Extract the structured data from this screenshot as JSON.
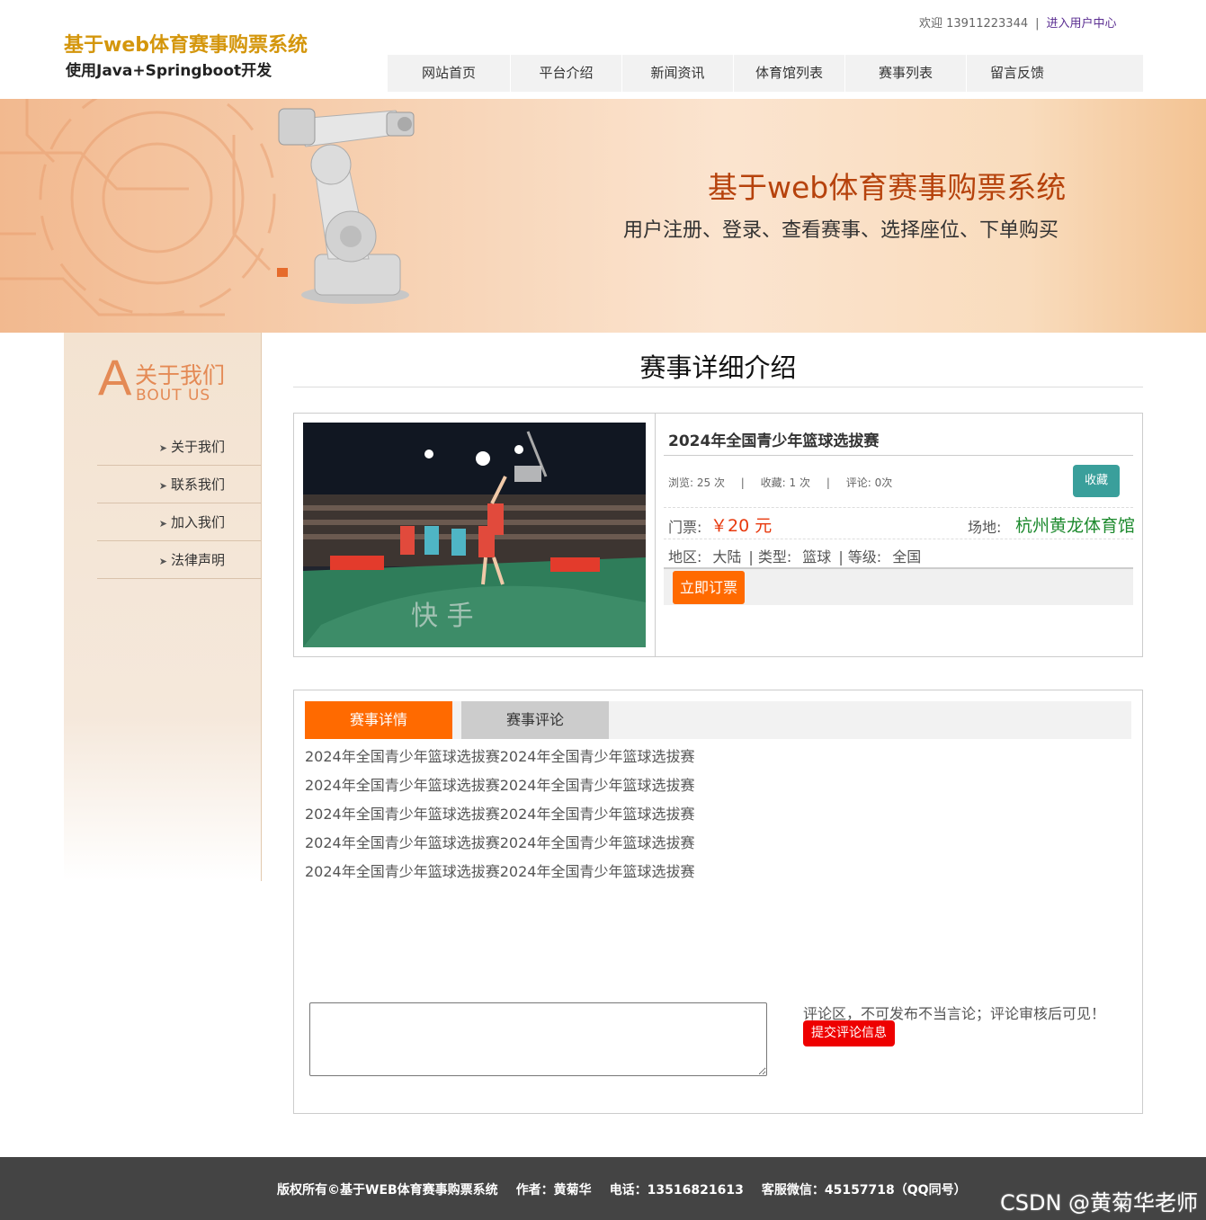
{
  "header": {
    "logo_title": "基于web体育赛事购票系统",
    "logo_subtitle": "使用Java+Springboot开发",
    "welcome": "欢迎 13911223344",
    "separator": "|",
    "user_center_link": "进入用户中心"
  },
  "nav": {
    "items": [
      {
        "label": "网站首页"
      },
      {
        "label": "平台介绍"
      },
      {
        "label": "新闻资讯"
      },
      {
        "label": "体育馆列表"
      },
      {
        "label": "赛事列表"
      },
      {
        "label": "留言反馈"
      }
    ]
  },
  "banner": {
    "title": "基于web体育赛事购票系统",
    "subtitle": "用户注册、登录、查看赛事、选择座位、下单购买"
  },
  "sidebar": {
    "about_letter": "A",
    "about_cn": "关于我们",
    "about_en": "BOUT US",
    "items": [
      {
        "label": "关于我们"
      },
      {
        "label": "联系我们"
      },
      {
        "label": "加入我们"
      },
      {
        "label": "法律声明"
      }
    ]
  },
  "main": {
    "page_title": "赛事详细介绍",
    "event": {
      "title": "2024年全国青少年篮球选拔赛",
      "views_label": "浏览:",
      "views": "25 次",
      "favorites_label": "收藏:",
      "favorites": "1 次",
      "comments_label": "评论:",
      "comments": "0次",
      "stat_separator": "|",
      "favorite_button": "收藏",
      "ticket_label": "门票:",
      "ticket_price": "￥20 元",
      "venue_label": "场地:",
      "venue": "杭州黄龙体育馆",
      "region_label": "地区:",
      "region": "大陆",
      "type_label": "| 类型:",
      "type": "篮球",
      "level_label": "| 等级:",
      "level": "全国",
      "buy_button": "立即订票"
    },
    "tabs": [
      {
        "label": "赛事详情",
        "active": true
      },
      {
        "label": "赛事评论",
        "active": false
      }
    ],
    "description_lines": [
      "2024年全国青少年篮球选拔赛2024年全国青少年篮球选拔赛",
      "2024年全国青少年篮球选拔赛2024年全国青少年篮球选拔赛",
      "2024年全国青少年篮球选拔赛2024年全国青少年篮球选拔赛",
      "2024年全国青少年篮球选拔赛2024年全国青少年篮球选拔赛",
      "2024年全国青少年篮球选拔赛2024年全国青少年篮球选拔赛"
    ],
    "comment_note": "评论区，不可发布不当言论；评论审核后可见！",
    "comment_submit": "提交评论信息",
    "comment_value": ""
  },
  "footer": {
    "copyright": "版权所有©基于WEB体育赛事购票系统",
    "author": "作者：黄菊华",
    "phone": "电话：13516821613",
    "wechat": "客服微信：45157718（QQ同号）"
  },
  "watermark": "CSDN @黄菊华老师",
  "colors": {
    "accent_orange": "#ff6a00",
    "logo_gold": "#d4960c",
    "banner_title": "#b6420c",
    "price_red": "#e8390e",
    "venue_green": "#1d8a2e",
    "favorite_teal": "#3a9f9b",
    "submit_red": "#ee0000",
    "footer_bg": "#444444"
  },
  "icons": {
    "sidebar_arrow": "chevron-right-icon"
  }
}
